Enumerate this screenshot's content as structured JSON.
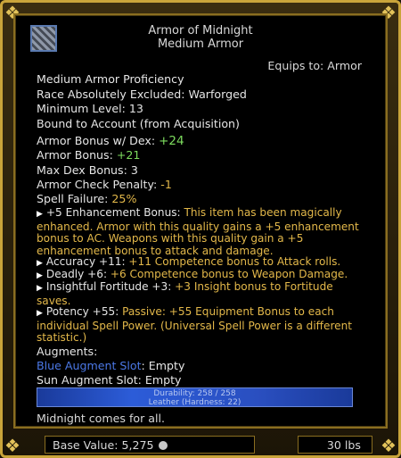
{
  "item": {
    "name": "Armor of Midnight",
    "type": "Medium Armor",
    "equips_to": "Equips to: Armor",
    "proficiency": "Medium Armor Proficiency",
    "race_excluded": "Race Absolutely Excluded: Warforged",
    "min_level": "Minimum Level: 13",
    "bound": "Bound to Account (from Acquisition)",
    "armor_bonus_dex_label": "Armor Bonus w/ Dex: ",
    "armor_bonus_dex_value": "+24",
    "armor_bonus_label": "Armor Bonus: ",
    "armor_bonus_value": "+21",
    "max_dex": "Max Dex Bonus: 3",
    "armor_check_label": "Armor Check Penalty: ",
    "armor_check_value": "-1",
    "spell_failure_label": "Spell Failure: ",
    "spell_failure_value": "25%"
  },
  "effects": {
    "enh_name": "+5 Enhancement Bonus:",
    "enh_desc": " This item has been magically enhanced. Armor with this quality gains a +5 enhancement bonus to AC. Weapons with this quality gain a +5 enhancement bonus to attack and damage.",
    "acc_name": "Accuracy +11:",
    "acc_desc": " +11 Competence bonus to Attack rolls.",
    "deadly_name": "Deadly +6:",
    "deadly_desc": " +6 Competence bonus to Weapon Damage.",
    "fort_name": "Insightful Fortitude +3:",
    "fort_desc": " +3 Insight bonus to Fortitude saves.",
    "pot_name": "Potency +55:",
    "pot_desc": " Passive: +55 Equipment Bonus to each individual Spell Power. (Universal Spell Power is a different statistic.)"
  },
  "augments": {
    "header": "Augments:",
    "blue_label": "Blue Augment Slot",
    "blue_value": ": Empty",
    "sun_label": "Sun Augment Slot",
    "sun_value": ": Empty"
  },
  "durability": {
    "text": "Durability: 258 / 258",
    "material": "Leather (Hardness: 22)"
  },
  "flavor": "Midnight comes for all.",
  "footer": {
    "base_value": "Base Value: 5,275",
    "weight": "30 lbs"
  },
  "colors": {
    "frame_gold": "#c9a43a",
    "stat_green": "#7ddc5e",
    "effect_orange": "#e3b84a",
    "augment_blue": "#4b78e6",
    "durability_blue": "#2c5cd8"
  },
  "icons": {
    "item": "armor-icon",
    "coin": "coin-icon"
  }
}
